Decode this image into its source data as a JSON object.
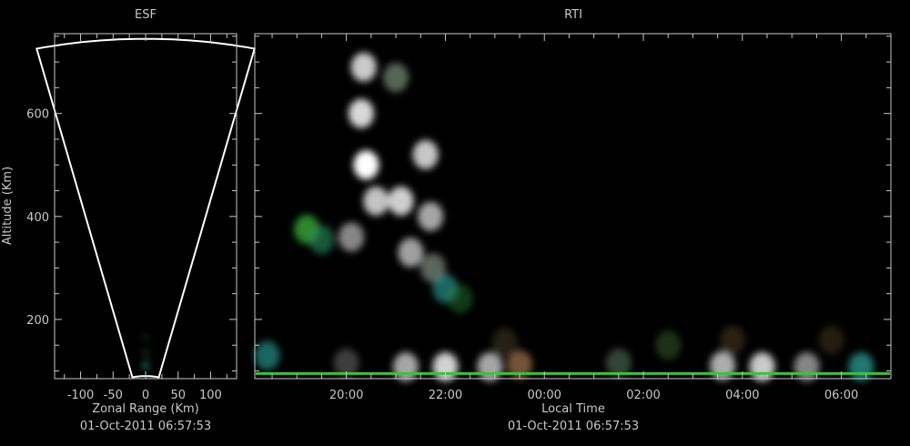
{
  "colors": {
    "background": "#000000",
    "axis": "#c8c8c8",
    "text": "#c8c8c8",
    "fan_outline": "#ffffff",
    "echo_green": "#3fbf3f",
    "echo_white": "#e8e8e8"
  },
  "chart_data": [
    {
      "type": "heatmap",
      "title": "ESF",
      "xlabel": "Zonal Range (Km)",
      "ylabel": "Altitude (Km)",
      "subtitle": "01-Oct-2011 06:57:53",
      "xlim": [
        -140,
        140
      ],
      "ylim": [
        85,
        755
      ],
      "x_ticks": [
        -100,
        -50,
        0,
        50,
        100
      ],
      "y_ticks": [
        200,
        400,
        600
      ],
      "beam_sector": {
        "half_angle_deg": 13,
        "min_altitude_km": 90,
        "max_altitude_km": 745
      },
      "echoes": [
        {
          "x": 0,
          "y": 110,
          "level": 0.6,
          "color": "#2fa8a0"
        },
        {
          "x": 0,
          "y": 135,
          "level": 0.4,
          "color": "#2a6f2a"
        },
        {
          "x": 0,
          "y": 165,
          "level": 0.3,
          "color": "#2a5f3a"
        }
      ]
    },
    {
      "type": "heatmap",
      "title": "RTI",
      "xlabel": "Local Time",
      "ylabel": "",
      "subtitle": "01-Oct-2011 06:57:53",
      "xlim": [
        18.15,
        31.0
      ],
      "ylim": [
        85,
        755
      ],
      "x_ticks": [
        "20:00",
        "22:00",
        "00:00",
        "02:00",
        "04:00",
        "06:00"
      ],
      "x_tick_hours": [
        20,
        22,
        24,
        26,
        28,
        30
      ],
      "y_ticks": [
        200,
        400,
        600
      ],
      "echoes": [
        {
          "x": 20.35,
          "y": 690,
          "level": 0.9,
          "color": "#e0e0e0"
        },
        {
          "x": 20.3,
          "y": 600,
          "level": 0.9,
          "color": "#f0f0f0"
        },
        {
          "x": 20.4,
          "y": 500,
          "level": 1.0,
          "color": "#ffffff"
        },
        {
          "x": 20.6,
          "y": 430,
          "level": 0.9,
          "color": "#d8d8d8"
        },
        {
          "x": 20.1,
          "y": 360,
          "level": 0.7,
          "color": "#c0c0c0"
        },
        {
          "x": 21.0,
          "y": 670,
          "level": 0.6,
          "color": "#8fa88f"
        },
        {
          "x": 21.1,
          "y": 430,
          "level": 0.9,
          "color": "#e6e6e6"
        },
        {
          "x": 21.3,
          "y": 330,
          "level": 0.8,
          "color": "#c8c8c8"
        },
        {
          "x": 21.6,
          "y": 520,
          "level": 0.9,
          "color": "#dcdcdc"
        },
        {
          "x": 21.7,
          "y": 400,
          "level": 0.8,
          "color": "#cfcfcf"
        },
        {
          "x": 21.75,
          "y": 300,
          "level": 0.6,
          "color": "#9aa89a"
        },
        {
          "x": 19.2,
          "y": 375,
          "level": 0.7,
          "color": "#3fbf3f"
        },
        {
          "x": 19.5,
          "y": 355,
          "level": 0.6,
          "color": "#2a8f5f"
        },
        {
          "x": 22.0,
          "y": 260,
          "level": 0.6,
          "color": "#2fa8a0"
        },
        {
          "x": 22.3,
          "y": 240,
          "level": 0.4,
          "color": "#2a8f3a"
        },
        {
          "x": 18.4,
          "y": 130,
          "level": 0.6,
          "color": "#2fa8a0"
        },
        {
          "x": 20.0,
          "y": 115,
          "level": 0.5,
          "color": "#7a7a7a"
        },
        {
          "x": 21.2,
          "y": 108,
          "level": 0.8,
          "color": "#d0d0d0"
        },
        {
          "x": 22.0,
          "y": 108,
          "level": 0.9,
          "color": "#e8e8e8"
        },
        {
          "x": 22.9,
          "y": 108,
          "level": 0.8,
          "color": "#cfcfcf"
        },
        {
          "x": 23.5,
          "y": 112,
          "level": 0.6,
          "color": "#c08a5a"
        },
        {
          "x": 23.2,
          "y": 155,
          "level": 0.4,
          "color": "#5a5030"
        },
        {
          "x": 25.5,
          "y": 115,
          "level": 0.5,
          "color": "#6a8a6a"
        },
        {
          "x": 26.5,
          "y": 150,
          "level": 0.4,
          "color": "#4a7a3a"
        },
        {
          "x": 27.6,
          "y": 110,
          "level": 0.8,
          "color": "#d8d8d8"
        },
        {
          "x": 28.4,
          "y": 108,
          "level": 0.9,
          "color": "#e0e0e0"
        },
        {
          "x": 29.3,
          "y": 108,
          "level": 0.7,
          "color": "#bdbdbd"
        },
        {
          "x": 30.4,
          "y": 108,
          "level": 0.7,
          "color": "#2fa8a0"
        },
        {
          "x": 27.8,
          "y": 160,
          "level": 0.4,
          "color": "#6a5030"
        },
        {
          "x": 29.8,
          "y": 160,
          "level": 0.4,
          "color": "#5a4a2a"
        }
      ],
      "ground_clutter": {
        "y": 95,
        "color": "#3fbf3f"
      }
    }
  ]
}
